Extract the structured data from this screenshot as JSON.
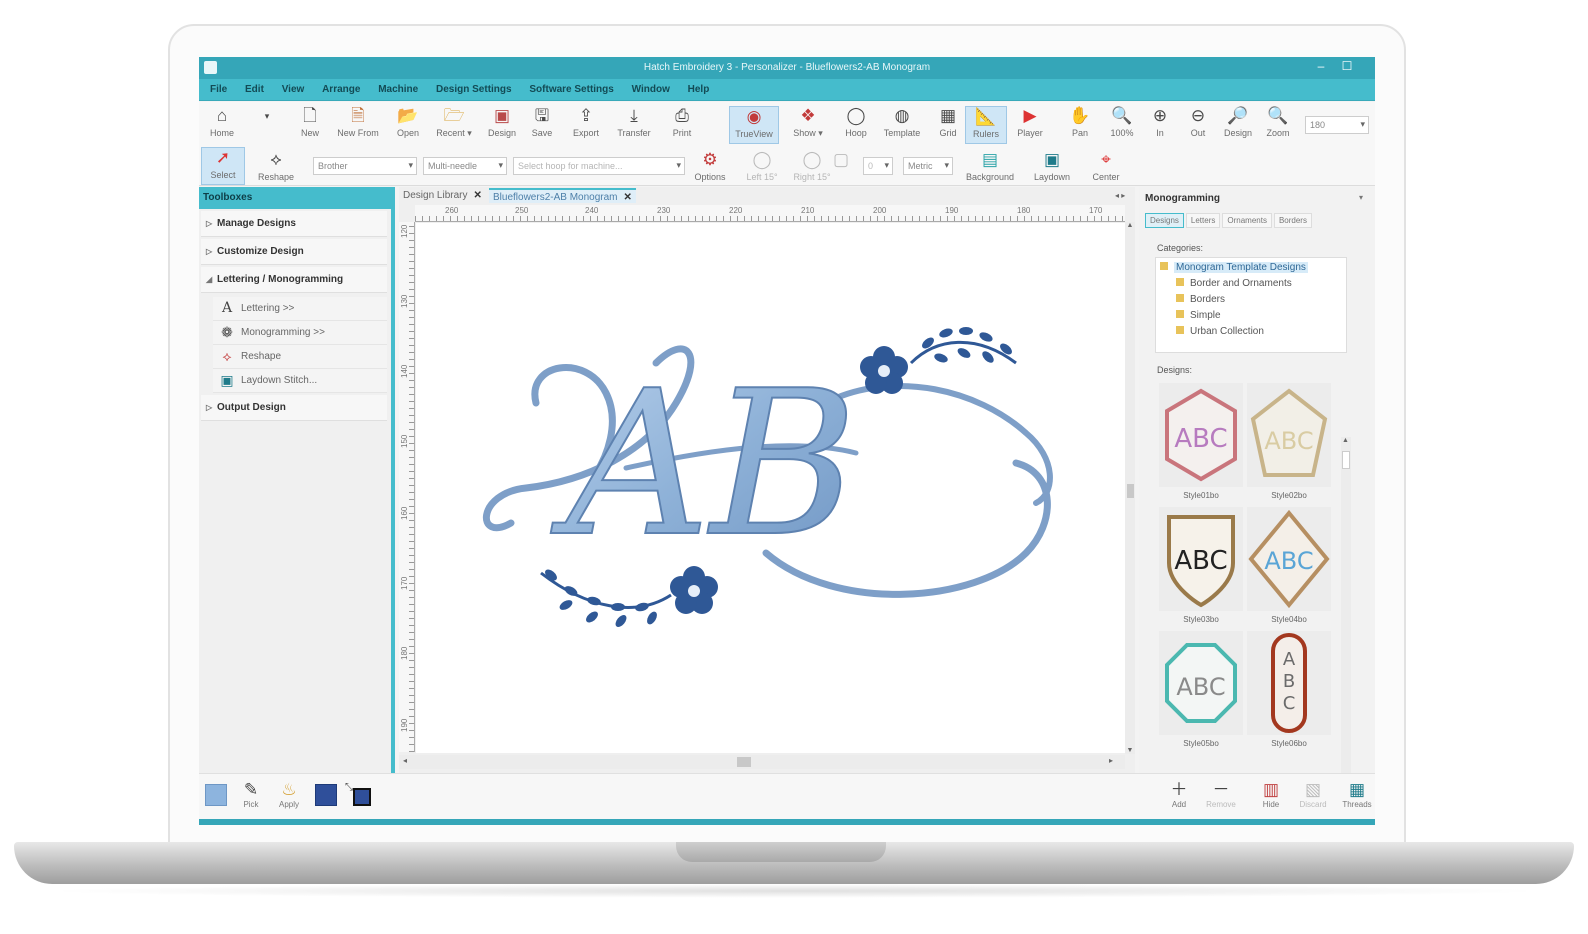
{
  "window": {
    "title": "Hatch Embroidery 3 - Personalizer - Blueflowers2-AB Monogram",
    "minimize": "–",
    "maximize": "☐"
  },
  "menu": [
    "File",
    "Edit",
    "View",
    "Arrange",
    "Machine",
    "Design Settings",
    "Software Settings",
    "Window",
    "Help"
  ],
  "toolbar": {
    "home": "Home",
    "new": "New",
    "new_from": "New From",
    "open": "Open",
    "recent": "Recent ▾",
    "design": "Design",
    "save": "Save",
    "export": "Export",
    "transfer": "Transfer",
    "print": "Print",
    "trueview": "TrueView",
    "show": "Show ▾",
    "hoop": "Hoop",
    "template": "Template",
    "grid": "Grid",
    "rulers": "Rulers",
    "player": "Player",
    "pan": "Pan",
    "zoom_100": "100%",
    "zoom_in": "In",
    "zoom_out": "Out",
    "zoom_design": "Design",
    "zoom": "Zoom",
    "zoom_value": "180"
  },
  "toolbar2": {
    "select": "Select",
    "reshape": "Reshape",
    "machine_brand": "Brother",
    "machine_type": "Multi-needle",
    "hoop_placeholder": "Select hoop for machine...",
    "options": "Options",
    "left": "Left 15°",
    "right": "Right 15°",
    "angle_value": "0",
    "units": "Metric",
    "background": "Background",
    "laydown": "Laydown",
    "center": "Center"
  },
  "toolboxes": {
    "title": "Toolboxes",
    "sections": [
      {
        "label": "Manage Designs",
        "expanded": false
      },
      {
        "label": "Customize Design",
        "expanded": false
      },
      {
        "label": "Lettering / Monogramming",
        "expanded": true
      },
      {
        "label": "Output Design",
        "expanded": false
      }
    ],
    "items": [
      "Lettering >>",
      "Monogramming >>",
      "Reshape",
      "Laydown Stitch..."
    ]
  },
  "doc_tabs": [
    {
      "label": "Design Library",
      "active": false
    },
    {
      "label": "Blueflowers2-AB Monogram",
      "active": true
    }
  ],
  "ruler_h": [
    "260",
    "250",
    "240",
    "230",
    "220",
    "210",
    "200",
    "190",
    "180",
    "170"
  ],
  "ruler_v": [
    "120",
    "130",
    "140",
    "150",
    "160",
    "170",
    "180",
    "190"
  ],
  "design": {
    "monogram": "AB",
    "thread_color": "#8fb2d8",
    "flower_color": "#2f5896"
  },
  "monogramming": {
    "title": "Monogramming",
    "tabs": [
      "Designs",
      "Letters",
      "Ornaments",
      "Borders"
    ],
    "categories_label": "Categories:",
    "categories": [
      {
        "label": "Monogram Template Designs",
        "selected": true,
        "level": 0
      },
      {
        "label": "Border and Ornaments",
        "selected": false,
        "level": 1
      },
      {
        "label": "Borders",
        "selected": false,
        "level": 1
      },
      {
        "label": "Simple",
        "selected": false,
        "level": 1
      },
      {
        "label": "Urban Collection",
        "selected": false,
        "level": 1
      }
    ],
    "designs_label": "Designs:",
    "designs": [
      {
        "name": "Style01bo",
        "text": "ABC",
        "border": "#c9757c",
        "fill": "#b77bbf"
      },
      {
        "name": "Style02bo",
        "text": "ABC",
        "border": "#c8b48a",
        "fill": "#d9cca3"
      },
      {
        "name": "Style03bo",
        "text": "ABC",
        "border": "#9a7a4a",
        "fill": "#222222"
      },
      {
        "name": "Style04bo",
        "text": "ABC",
        "border": "#b68f62",
        "fill": "#5aa5d6"
      },
      {
        "name": "Style05bo",
        "text": "ABC",
        "border": "#4bb8b0",
        "fill": "#8a8a8a"
      },
      {
        "name": "Style06bo",
        "text": "ABC",
        "border": "#a3381f",
        "fill": "#6b6b6b"
      }
    ]
  },
  "bottombar": {
    "pick": "Pick",
    "apply": "Apply",
    "add": "Add",
    "remove": "Remove",
    "hide": "Hide",
    "discard": "Discard",
    "threads": "Threads"
  }
}
